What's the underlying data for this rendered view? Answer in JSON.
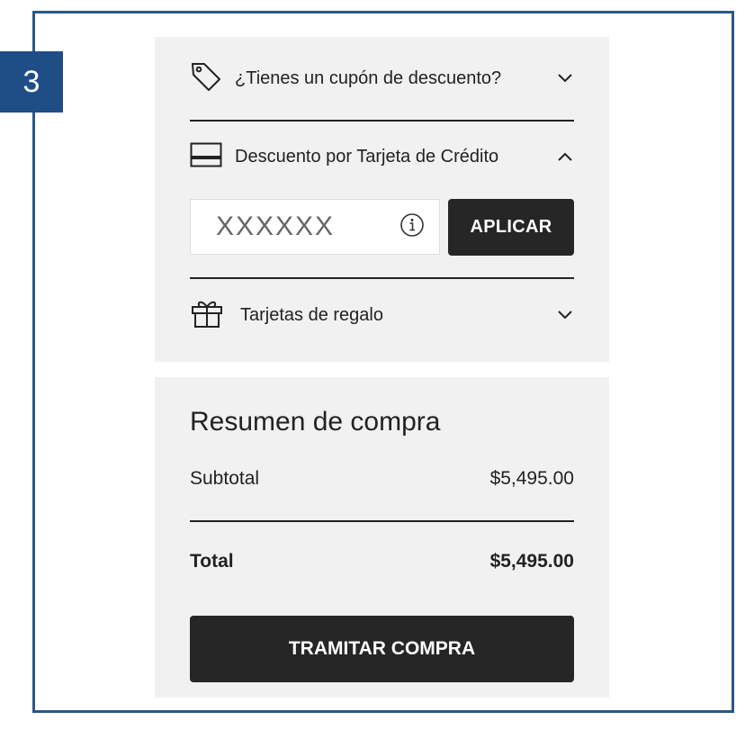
{
  "step": {
    "number": "3"
  },
  "discounts": {
    "coupon": {
      "label": "¿Tienes un cupón de descuento?",
      "icon": "tag-icon",
      "state": "collapsed"
    },
    "credit_card": {
      "label": "Descuento por Tarjeta de Crédito",
      "icon": "credit-card-icon",
      "state": "expanded",
      "input_placeholder": "XXXXXX",
      "apply_label": "APLICAR"
    },
    "gift_cards": {
      "label": "Tarjetas de regalo",
      "icon": "gift-icon",
      "state": "collapsed"
    }
  },
  "summary": {
    "title": "Resumen de compra",
    "subtotal_label": "Subtotal",
    "subtotal_value": "$5,495.00",
    "total_label": "Total",
    "total_value": "$5,495.00",
    "checkout_label": "TRAMITAR COMPRA"
  },
  "colors": {
    "frame": "#2a5788",
    "badge": "#1f4e86",
    "panel": "#f1f1f1",
    "button": "#262626"
  }
}
